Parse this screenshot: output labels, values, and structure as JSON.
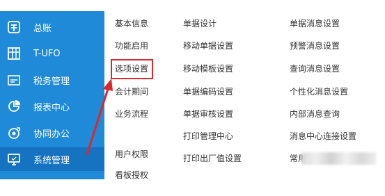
{
  "sidebar": {
    "items": [
      {
        "label": "总账",
        "icon": "ledger-icon"
      },
      {
        "label": "T-UFO",
        "icon": "ufo-report-icon"
      },
      {
        "label": "税务管理",
        "icon": "tax-icon"
      },
      {
        "label": "报表中心",
        "icon": "pie-chart-icon"
      },
      {
        "label": "协同办公",
        "icon": "collaboration-icon"
      },
      {
        "label": "系统管理",
        "icon": "monitor-settings-icon",
        "active": true
      }
    ]
  },
  "menu": {
    "column1": [
      "基本信息",
      "功能启用",
      "选项设置",
      "会计期间",
      "业务流程",
      "用户权限",
      "看板授权"
    ],
    "column2": [
      "单据设计",
      "移动单据设置",
      "移动模板设置",
      "单据编码设置",
      "单据审核设置",
      "打印管理中心",
      "打印出厂值设置"
    ],
    "column3": [
      "单据消息设置",
      "预警消息设置",
      "查询消息设置",
      "个性化消息设置",
      "内部消息查询",
      "消息中心连接设置",
      "常用"
    ]
  },
  "colors": {
    "sidebar_bg": "#1f8ad8",
    "sidebar_active_bg": "#1673c2",
    "highlight": "#e0262b",
    "menu_text": "#333333"
  }
}
